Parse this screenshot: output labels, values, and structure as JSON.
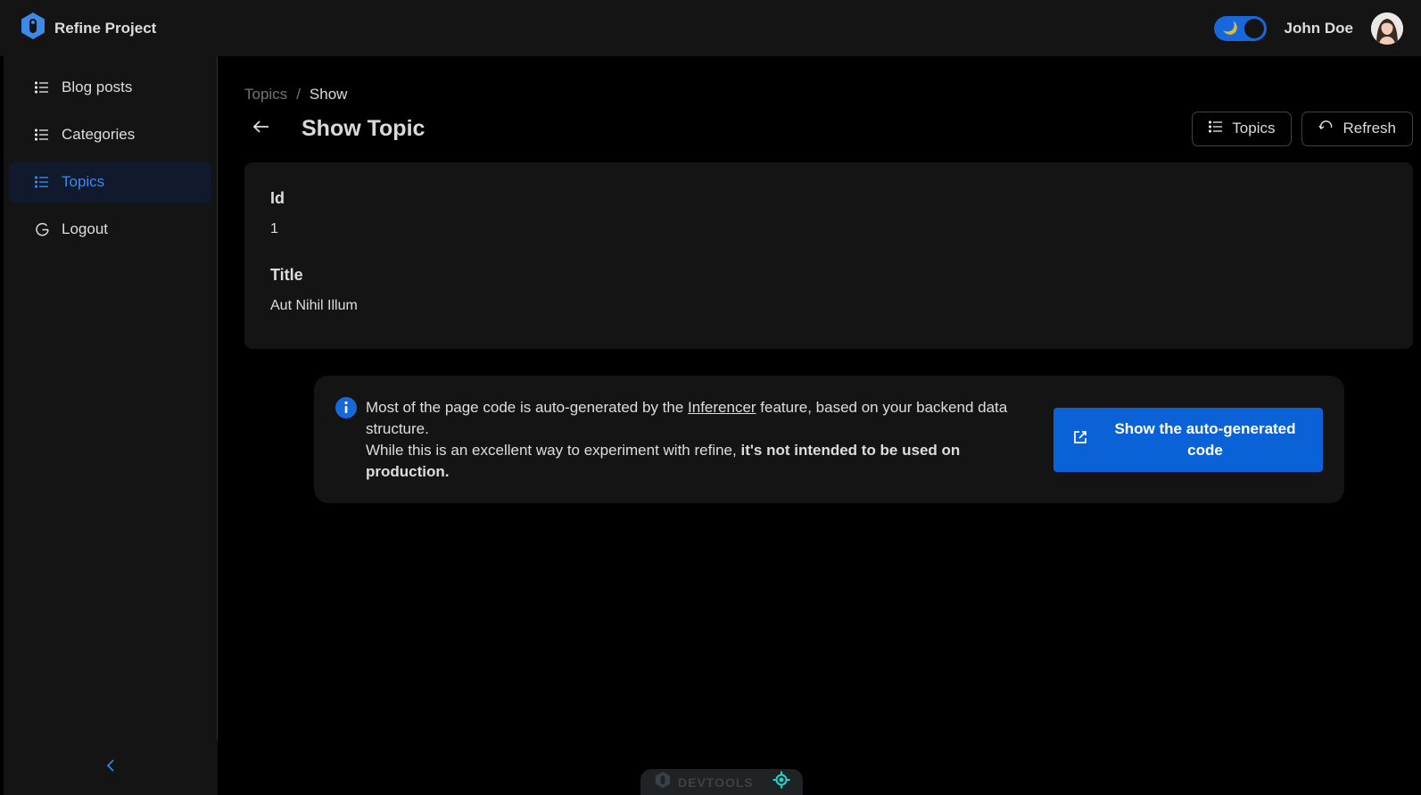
{
  "header": {
    "brand_title": "Refine Project",
    "theme_toggle_icon": "🌙",
    "user_name": "John Doe"
  },
  "sidebar": {
    "items": [
      {
        "label": "Blog posts",
        "icon": "list-icon",
        "active": false
      },
      {
        "label": "Categories",
        "icon": "list-icon",
        "active": false
      },
      {
        "label": "Topics",
        "icon": "list-icon",
        "active": true
      },
      {
        "label": "Logout",
        "icon": "logout-icon",
        "active": false
      }
    ],
    "collapse_icon": "chevron-left-icon"
  },
  "breadcrumb": {
    "items": [
      "Topics",
      "Show"
    ],
    "separator": "/"
  },
  "page": {
    "title": "Show Topic",
    "actions": {
      "list_label": "Topics",
      "refresh_label": "Refresh"
    }
  },
  "record": {
    "fields": [
      {
        "label": "Id",
        "value": "1"
      },
      {
        "label": "Title",
        "value": "Aut Nihil Illum"
      }
    ]
  },
  "alert": {
    "text_before_link": "Most of the page code is auto-generated by the ",
    "link": "Inferencer",
    "text_after_link": " feature, based on your backend data structure.",
    "line2_normal": "While this is an excellent way to experiment with refine, ",
    "line2_bold": "it's not intended to be used on production.",
    "button_label": "Show the auto-generated code"
  },
  "devtools": {
    "label": "DEVTOOLS"
  },
  "colors": {
    "primary": "#1668dc",
    "active_text": "#3c89e8",
    "header_bg": "#141414",
    "page_bg": "#000000",
    "code_button": "#0b62d6"
  }
}
